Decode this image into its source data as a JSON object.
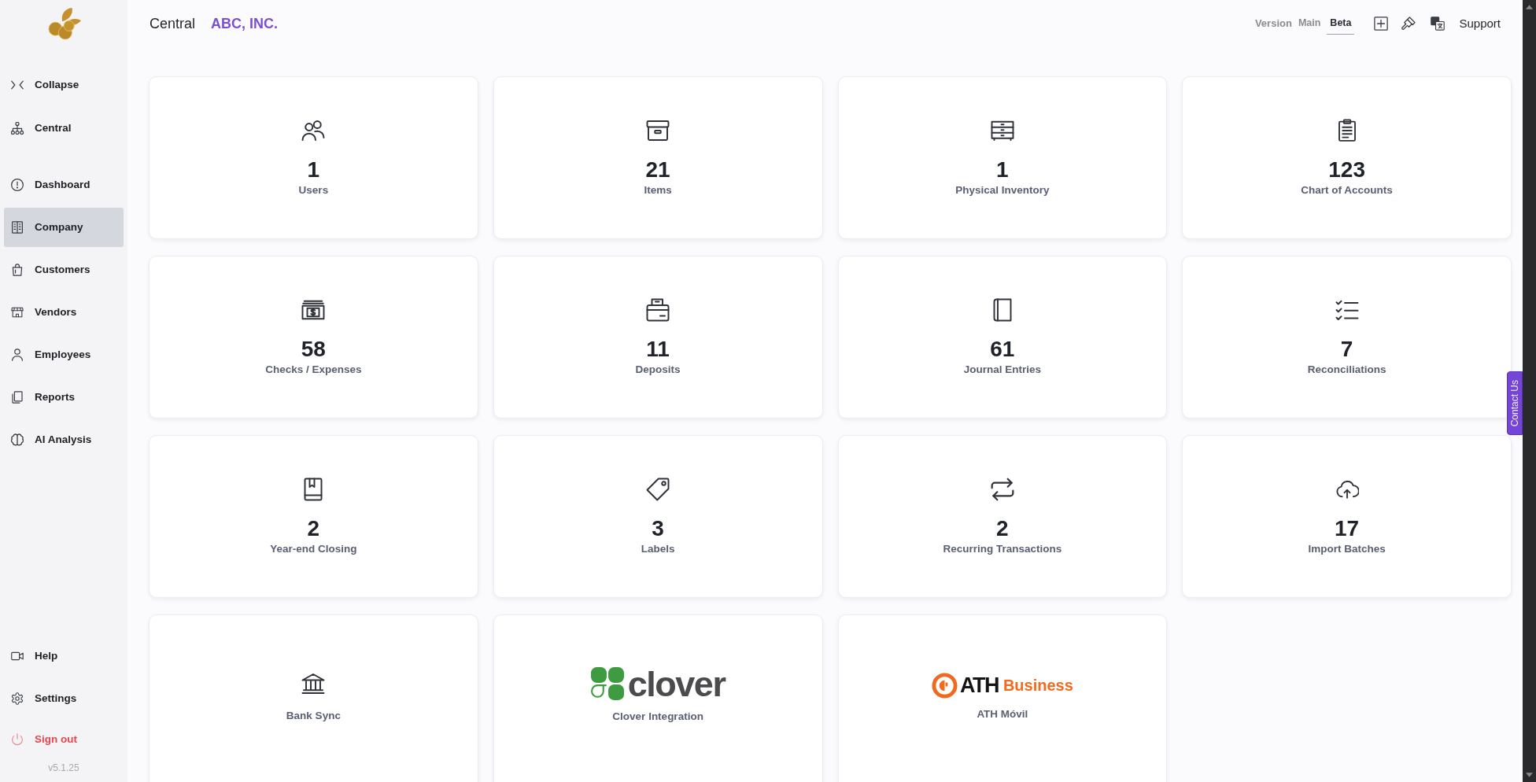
{
  "sidebar": {
    "collapse": "Collapse",
    "items": [
      {
        "label": "Central",
        "selected": false
      },
      {
        "label": "Dashboard",
        "selected": false
      },
      {
        "label": "Company",
        "selected": true
      },
      {
        "label": "Customers",
        "selected": false
      },
      {
        "label": "Vendors",
        "selected": false
      },
      {
        "label": "Employees",
        "selected": false
      },
      {
        "label": "Reports",
        "selected": false
      },
      {
        "label": "AI Analysis",
        "selected": false
      }
    ],
    "footer_items": [
      {
        "label": "Help",
        "kind": "link"
      },
      {
        "label": "Settings",
        "kind": "link"
      },
      {
        "label": "Sign out",
        "kind": "danger"
      }
    ],
    "version": "v5.1.25"
  },
  "header": {
    "section": "Central",
    "company": "ABC, INC.",
    "version_label": "Version",
    "versions": [
      {
        "label": "Main",
        "selected": false
      },
      {
        "label": "Beta",
        "selected": true
      }
    ],
    "support": "Support"
  },
  "cards": [
    {
      "kind": "count",
      "count": "1",
      "label": "Users"
    },
    {
      "kind": "count",
      "count": "21",
      "label": "Items"
    },
    {
      "kind": "count",
      "count": "1",
      "label": "Physical Inventory"
    },
    {
      "kind": "count",
      "count": "123",
      "label": "Chart of Accounts"
    },
    {
      "kind": "count",
      "count": "58",
      "label": "Checks / Expenses"
    },
    {
      "kind": "count",
      "count": "11",
      "label": "Deposits"
    },
    {
      "kind": "count",
      "count": "61",
      "label": "Journal Entries"
    },
    {
      "kind": "count",
      "count": "7",
      "label": "Reconciliations"
    },
    {
      "kind": "count",
      "count": "2",
      "label": "Year-end Closing"
    },
    {
      "kind": "count",
      "count": "3",
      "label": "Labels"
    },
    {
      "kind": "count",
      "count": "2",
      "label": "Recurring Transactions"
    },
    {
      "kind": "count",
      "count": "17",
      "label": "Import Batches"
    },
    {
      "kind": "plain",
      "label": "Bank Sync"
    },
    {
      "kind": "logo",
      "logo_words": [
        "clover"
      ],
      "label": "Clover Integration"
    },
    {
      "kind": "logo",
      "logo_words": [
        "ATH",
        "Business"
      ],
      "label": "ATH Móvil"
    }
  ],
  "contact_tab": "Contact Us"
}
